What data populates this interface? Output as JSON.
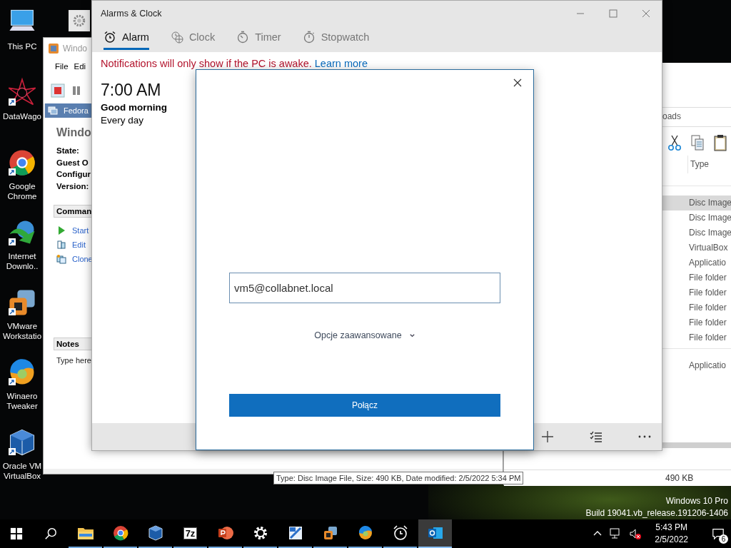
{
  "desktop_icons": [
    {
      "kind": "pc",
      "label": "This PC",
      "shortcut": false
    },
    {
      "kind": "datawagon",
      "label": "DataWago",
      "shortcut": true
    },
    {
      "kind": "chrome",
      "label": "Google Chrome",
      "shortcut": true
    },
    {
      "kind": "idm",
      "label": "Internet Downlo..",
      "shortcut": true
    },
    {
      "kind": "vmware",
      "label": "VMware Workstatio",
      "shortcut": true
    },
    {
      "kind": "winaero",
      "label": "Winaero Tweaker",
      "shortcut": true
    },
    {
      "kind": "vbox",
      "label": "Oracle VM VirtualBox",
      "shortcut": true
    }
  ],
  "virtualbox_window": {
    "title": "Windo",
    "menu": [
      "File",
      "Edi"
    ],
    "vm_tab": "Fedora",
    "vm_name": "Windo",
    "details": [
      "State:",
      "Guest O",
      "Configur",
      "Version:"
    ],
    "commands_header": "Comman",
    "commands": [
      {
        "kind": "start",
        "label": "Start"
      },
      {
        "kind": "edit",
        "label": "Edit"
      },
      {
        "kind": "clone",
        "label": "Clone"
      }
    ],
    "notes_header": "Notes",
    "notes_placeholder": "Type here"
  },
  "explorer_window": {
    "breadcrumb": "oads",
    "column": "Type",
    "groups": [
      {
        "rows": [
          {
            "type": "Disc Image",
            "selected": true
          },
          {
            "type": "Disc Image",
            "selected": false
          },
          {
            "type": "Disc Image",
            "selected": false
          },
          {
            "type": "VirtualBox",
            "selected": false
          },
          {
            "type": "Applicatio",
            "selected": false
          },
          {
            "type": "File folder",
            "selected": false
          },
          {
            "type": "File folder",
            "selected": false
          },
          {
            "type": "File folder",
            "selected": false
          },
          {
            "type": "File folder",
            "selected": false
          },
          {
            "type": "File folder",
            "selected": false
          }
        ]
      },
      {
        "rows": [
          {
            "type": "Applicatio",
            "selected": false
          }
        ]
      }
    ],
    "status": "490 KB",
    "tooltip": "Type: Disc Image File, Size: 490 KB, Date modified: 2/5/2022 5:34 PM"
  },
  "alarms_window": {
    "title": "Alarms & Clock",
    "tabs": [
      {
        "kind": "alarm",
        "label": "Alarm",
        "selected": true
      },
      {
        "kind": "clock",
        "label": "Clock",
        "selected": false
      },
      {
        "kind": "timer",
        "label": "Timer",
        "selected": false
      },
      {
        "kind": "stopwatch",
        "label": "Stopwatch",
        "selected": false
      }
    ],
    "notice": "Notifications will only show if the PC is awake.",
    "notice_link": "Learn more",
    "alarms": [
      {
        "time": "7:00 AM",
        "name": "Good morning",
        "repeat": "Every day"
      }
    ]
  },
  "dialog": {
    "email": "vm5@collabnet.local",
    "advanced": "Opcje zaawansowane",
    "connect": "Połącz"
  },
  "os_edition": [
    "Windows 10 Pro",
    "Build 19041.vb_release.191206-1406"
  ],
  "taskbar": {
    "apps": [
      {
        "kind": "explorer",
        "active": false
      },
      {
        "kind": "chrome",
        "active": false
      },
      {
        "kind": "vbox",
        "active": false
      },
      {
        "kind": "sevenzip",
        "label": "7z",
        "active": false
      },
      {
        "kind": "powerpoint",
        "active": false
      },
      {
        "kind": "settings",
        "active": false
      },
      {
        "kind": "calc",
        "active": false
      },
      {
        "kind": "vmware",
        "active": false
      },
      {
        "kind": "winaero",
        "active": false
      },
      {
        "kind": "alarm",
        "active": false
      },
      {
        "kind": "outlook",
        "active": true
      }
    ],
    "time": "5:43 PM",
    "date": "2/5/2022",
    "notifications": "6"
  }
}
